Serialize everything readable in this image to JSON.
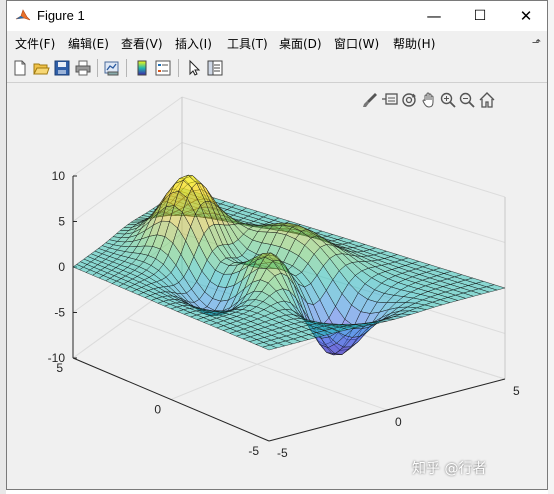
{
  "window": {
    "title": "Figure 1",
    "minimize": "—",
    "maximize": "☐",
    "close": "✕"
  },
  "menu": {
    "items": [
      "文件(F)",
      "编辑(E)",
      "查看(V)",
      "插入(I)",
      "工具(T)",
      "桌面(D)",
      "窗口(W)",
      "帮助(H)"
    ],
    "pin": "⬏"
  },
  "toolbar_icons": [
    "new-figure-icon",
    "open-file-icon",
    "save-icon",
    "print-icon",
    "link-plot-icon",
    "insert-colorbar-icon",
    "insert-legend-icon",
    "edit-plot-pointer-icon",
    "property-inspector-icon"
  ],
  "axes_toolbar_icons": [
    "brush-icon",
    "data-tips-icon",
    "rotate-3d-icon",
    "pan-icon",
    "zoom-in-icon",
    "zoom-out-icon",
    "home-restore-view-icon"
  ],
  "chart_data": {
    "type": "surface",
    "function": "peaks",
    "x_range": [
      -3,
      3
    ],
    "y_range": [
      -3,
      3
    ],
    "grid": "31x31",
    "colormap": "parula",
    "face_alpha": 0.5,
    "zlim": [
      -10,
      10
    ],
    "z_ticks": [
      "10",
      "5",
      "0",
      "-5",
      "-10"
    ],
    "y_ticks": [
      "5",
      "0",
      "-5"
    ],
    "x_ticks": [
      "-5",
      "0",
      "5"
    ],
    "view": {
      "azimuth": -37.5,
      "elevation": 30
    }
  },
  "watermark": "知乎 @行者"
}
